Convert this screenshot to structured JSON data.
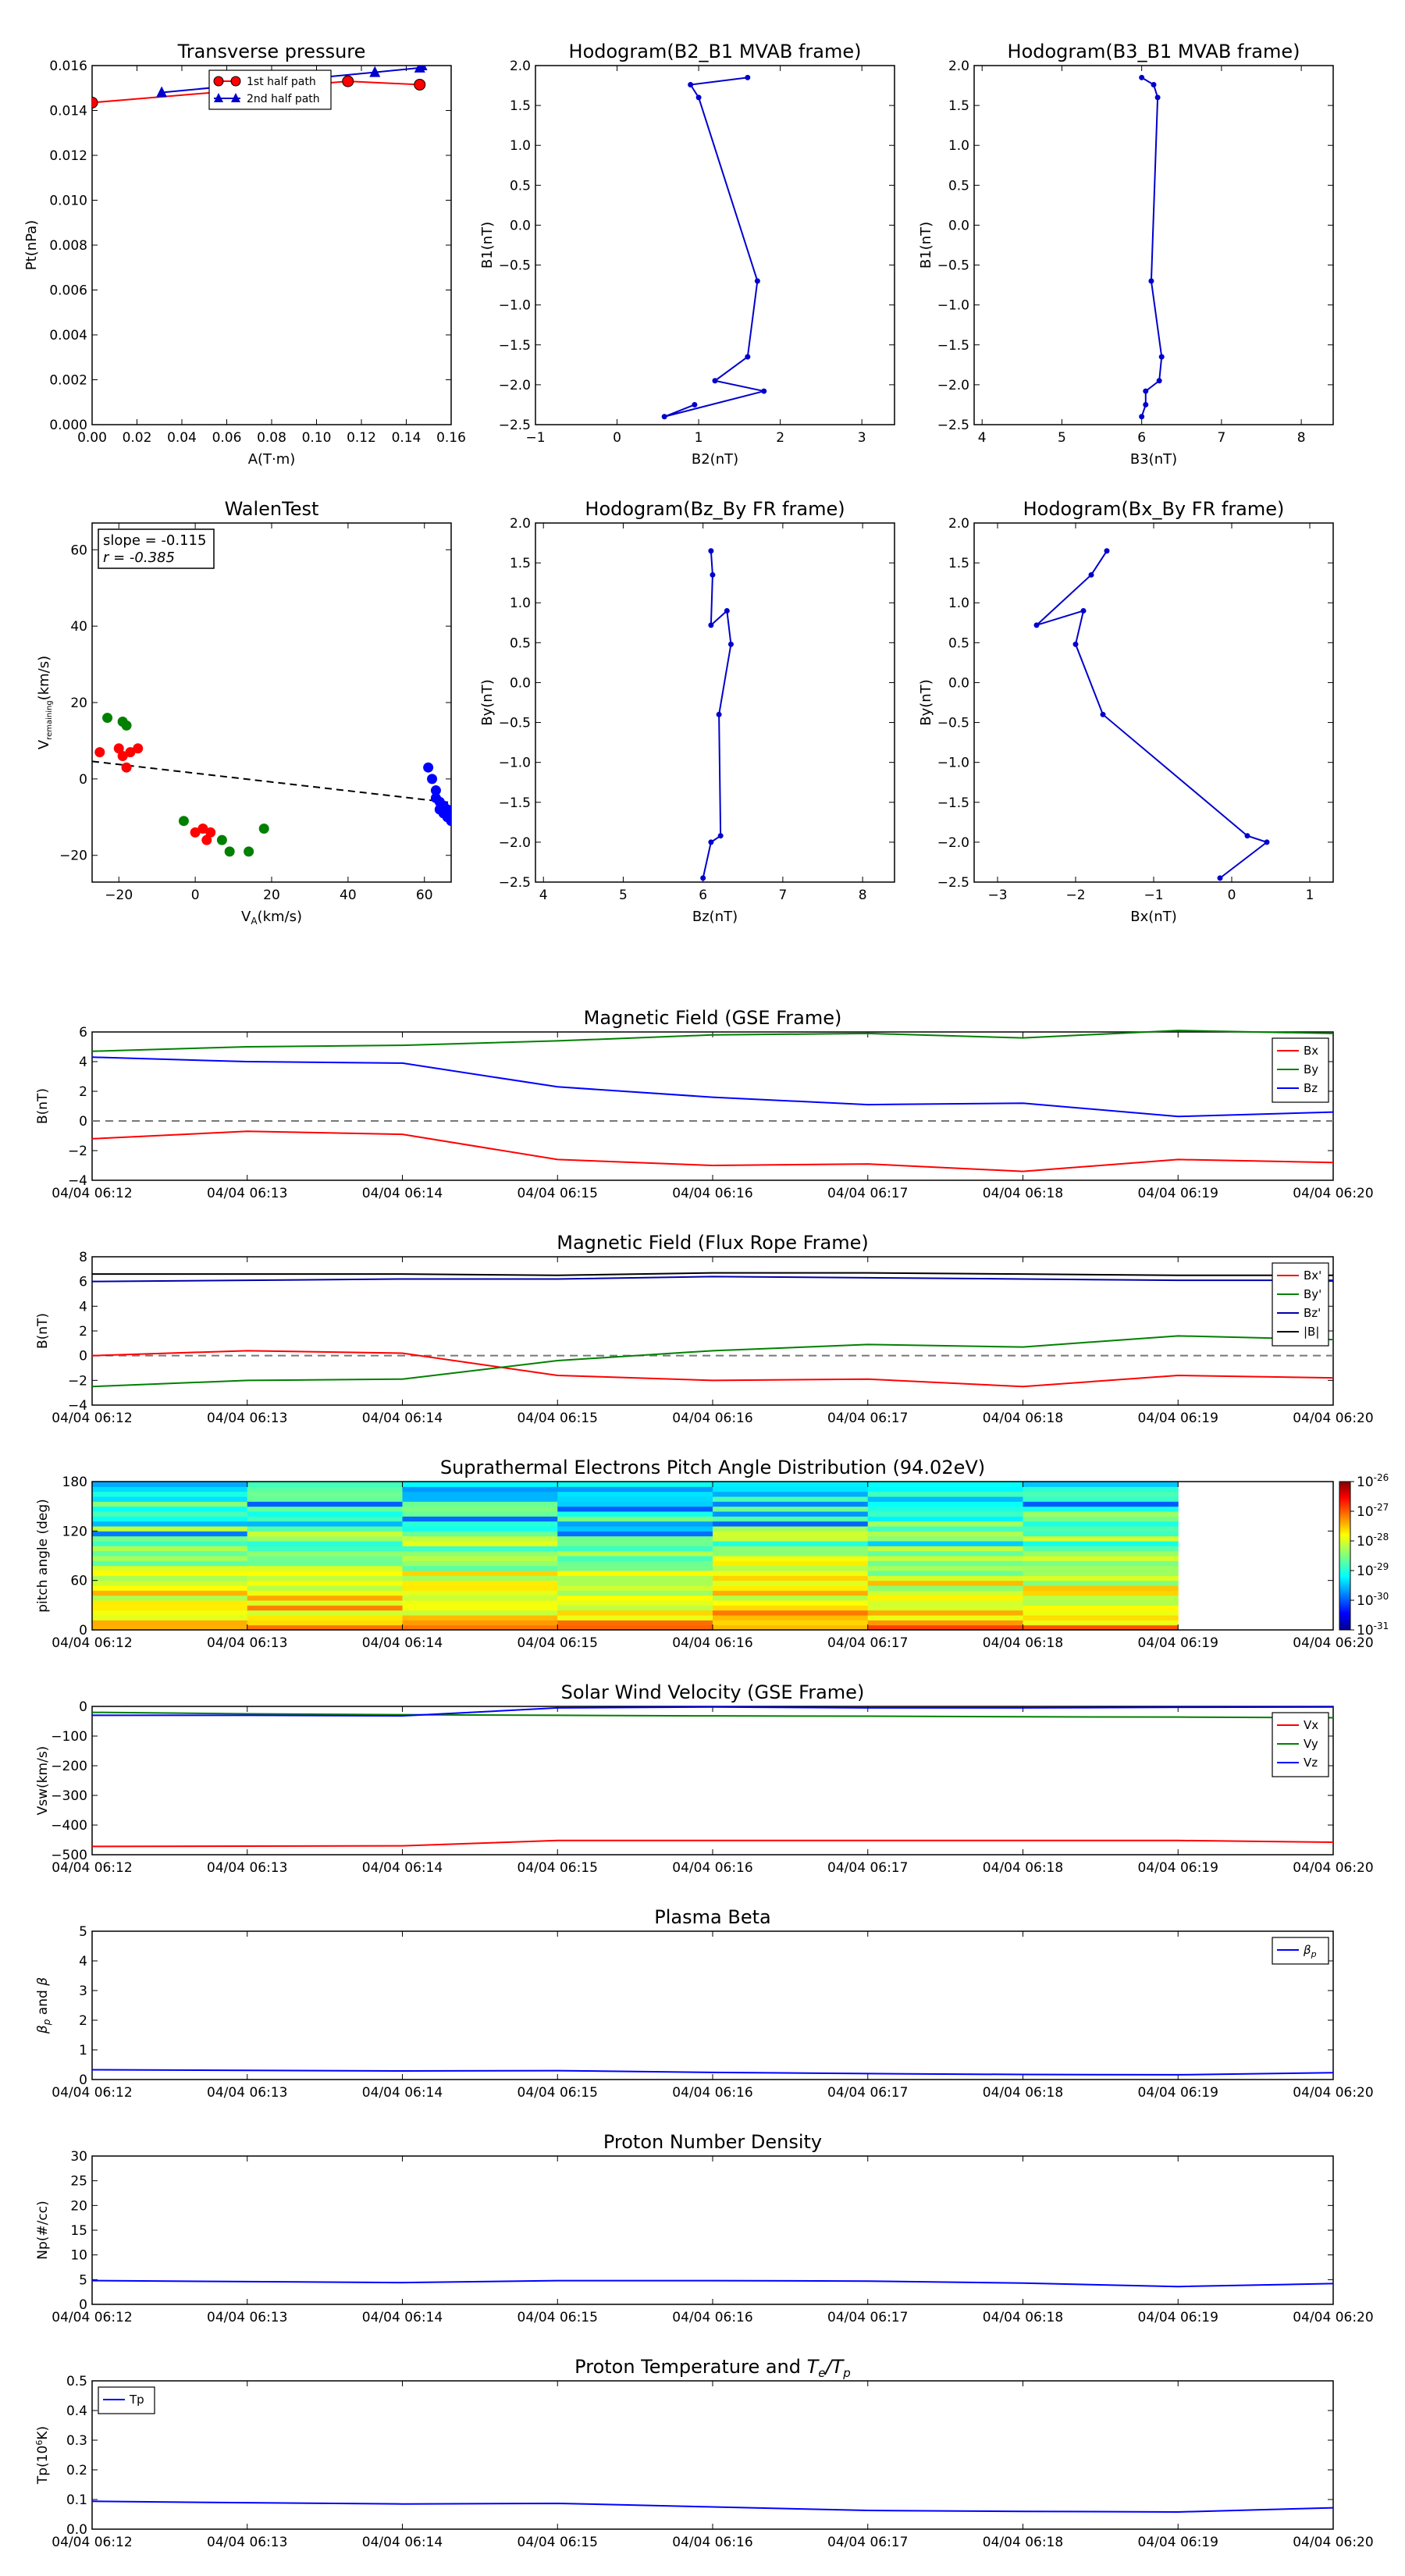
{
  "hodograms": [
    {
      "title": "Transverse pressure",
      "type": "line",
      "xlabel": "A(T·m)",
      "ylabel": "Pt(nPa)",
      "xlim": [
        0,
        0.16
      ],
      "ylim": [
        0,
        0.016
      ],
      "xticks": [
        0,
        0.02,
        0.04,
        0.06,
        0.08,
        0.1,
        0.12,
        0.14,
        0.16
      ],
      "xtick_labels": [
        "0.00",
        "0.02",
        "0.04",
        "0.06",
        "0.08",
        "0.10",
        "0.12",
        "0.14",
        "0.16"
      ],
      "yticks": [
        0,
        0.002,
        0.004,
        0.006,
        0.008,
        0.01,
        0.012,
        0.014,
        0.016
      ],
      "ytick_labels": [
        "0.000",
        "0.002",
        "0.004",
        "0.006",
        "0.008",
        "0.010",
        "0.012",
        "0.014",
        "0.016"
      ],
      "legend": {
        "position": "top-center",
        "entries": [
          "1st half path",
          "2nd half path"
        ]
      },
      "series": [
        {
          "name": "1st half path",
          "color": "#ff0000",
          "marker": "circle",
          "x": [
            0.0,
            0.114,
            0.146
          ],
          "y": [
            0.01435,
            0.0153,
            0.01515
          ]
        },
        {
          "name": "2nd half path",
          "color": "#0000cc",
          "marker": "triangle",
          "x": [
            0.031,
            0.126,
            0.146,
            0.147
          ],
          "y": [
            0.0148,
            0.0157,
            0.0159,
            0.016
          ]
        }
      ]
    },
    {
      "title": "Hodogram(B2_B1 MVAB frame)",
      "type": "line",
      "xlabel": "B2(nT)",
      "ylabel": "B1(nT)",
      "xlim": [
        -1,
        3.4
      ],
      "ylim": [
        -2.5,
        2.0
      ],
      "xticks": [
        -1,
        0,
        1,
        2,
        3
      ],
      "xtick_labels": [
        "−1",
        "0",
        "1",
        "2",
        "3"
      ],
      "yticks": [
        -2.5,
        -2.0,
        -1.5,
        -1.0,
        -0.5,
        0,
        0.5,
        1.0,
        1.5,
        2.0
      ],
      "ytick_labels": [
        "−2.5",
        "−2.0",
        "−1.5",
        "−1.0",
        "−0.5",
        "0.0",
        "0.5",
        "1.0",
        "1.5",
        "2.0"
      ],
      "series": [
        {
          "color": "#0000cc",
          "marker": "dot",
          "x": [
            1.6,
            0.9,
            1.0,
            1.72,
            1.6,
            1.2,
            1.8,
            0.58,
            0.95
          ],
          "y": [
            1.85,
            1.76,
            1.6,
            -0.7,
            -1.65,
            -1.95,
            -2.08,
            -2.4,
            -2.25
          ]
        }
      ]
    },
    {
      "title": "Hodogram(B3_B1 MVAB frame)",
      "type": "line",
      "xlabel": "B3(nT)",
      "ylabel": "B1(nT)",
      "xlim": [
        3.9,
        8.4
      ],
      "ylim": [
        -2.5,
        2.0
      ],
      "xticks": [
        4,
        5,
        6,
        7,
        8
      ],
      "xtick_labels": [
        "4",
        "5",
        "6",
        "7",
        "8"
      ],
      "yticks": [
        -2.5,
        -2.0,
        -1.5,
        -1.0,
        -0.5,
        0,
        0.5,
        1.0,
        1.5,
        2.0
      ],
      "ytick_labels": [
        "−2.5",
        "−2.0",
        "−1.5",
        "−1.0",
        "−0.5",
        "0.0",
        "0.5",
        "1.0",
        "1.5",
        "2.0"
      ],
      "series": [
        {
          "color": "#0000cc",
          "marker": "dot",
          "x": [
            6.0,
            6.15,
            6.2,
            6.12,
            6.25,
            6.22,
            6.05,
            6.05,
            6.0
          ],
          "y": [
            1.85,
            1.76,
            1.6,
            -0.7,
            -1.65,
            -1.95,
            -2.08,
            -2.25,
            -2.4
          ]
        }
      ]
    },
    {
      "title": "WalenTest",
      "type": "scatter",
      "xlabel": "V_A(km/s)",
      "ylabel": "V_remaining(km/s)",
      "xlim": [
        -27,
        67
      ],
      "ylim": [
        -27,
        67
      ],
      "xticks": [
        -20,
        0,
        20,
        40,
        60
      ],
      "xtick_labels": [
        "−20",
        "0",
        "20",
        "40",
        "60"
      ],
      "yticks": [
        -20,
        0,
        20,
        40,
        60
      ],
      "ytick_labels": [
        "−20",
        "0",
        "20",
        "40",
        "60"
      ],
      "annotation": [
        "slope = -0.115",
        "r = -0.385"
      ],
      "fit_line": {
        "slope": -0.115,
        "intercept": 1.5,
        "x": [
          -27,
          67
        ]
      },
      "series": [
        {
          "color": "#ff0000",
          "x": [
            -25,
            -20,
            -17,
            -15,
            -19,
            -18,
            0,
            2,
            4,
            3
          ],
          "y": [
            7,
            8,
            7,
            8,
            6,
            3,
            -14,
            -13,
            -14,
            -16
          ]
        },
        {
          "color": "#008000",
          "x": [
            -23,
            -19,
            -18,
            -3,
            7,
            9,
            14,
            18
          ],
          "y": [
            16,
            15,
            14,
            -11,
            -16,
            -19,
            -19,
            -13
          ]
        },
        {
          "color": "#0000ff",
          "x": [
            61,
            62,
            63,
            63,
            64,
            64,
            65,
            65,
            66,
            66,
            66,
            67
          ],
          "y": [
            3,
            0,
            -3,
            -5,
            -6,
            -8,
            -7,
            -9,
            -9,
            -8,
            -10,
            -11
          ]
        }
      ]
    },
    {
      "title": "Hodogram(Bz_By FR frame)",
      "type": "line",
      "xlabel": "Bz(nT)",
      "ylabel": "By(nT)",
      "xlim": [
        3.9,
        8.4
      ],
      "ylim": [
        -2.5,
        2.0
      ],
      "xticks": [
        4,
        5,
        6,
        7,
        8
      ],
      "xtick_labels": [
        "4",
        "5",
        "6",
        "7",
        "8"
      ],
      "yticks": [
        -2.5,
        -2.0,
        -1.5,
        -1.0,
        -0.5,
        0,
        0.5,
        1.0,
        1.5,
        2.0
      ],
      "ytick_labels": [
        "−2.5",
        "−2.0",
        "−1.5",
        "−1.0",
        "−0.5",
        "0.0",
        "0.5",
        "1.0",
        "1.5",
        "2.0"
      ],
      "series": [
        {
          "color": "#0000cc",
          "marker": "dot",
          "x": [
            6.1,
            6.12,
            6.1,
            6.3,
            6.35,
            6.2,
            6.22,
            6.1,
            6.0
          ],
          "y": [
            1.65,
            1.35,
            0.72,
            0.9,
            0.48,
            -0.4,
            -1.92,
            -2.0,
            -2.45
          ]
        }
      ]
    },
    {
      "title": "Hodogram(Bx_By FR frame)",
      "type": "line",
      "xlabel": "Bx(nT)",
      "ylabel": "By(nT)",
      "xlim": [
        -3.3,
        1.3
      ],
      "ylim": [
        -2.5,
        2.0
      ],
      "xticks": [
        -3,
        -2,
        -1,
        0,
        1
      ],
      "xtick_labels": [
        "−3",
        "−2",
        "−1",
        "0",
        "1"
      ],
      "yticks": [
        -2.5,
        -2.0,
        -1.5,
        -1.0,
        -0.5,
        0,
        0.5,
        1.0,
        1.5,
        2.0
      ],
      "ytick_labels": [
        "−2.5",
        "−2.0",
        "−1.5",
        "−1.0",
        "−0.5",
        "0.0",
        "0.5",
        "1.0",
        "1.5",
        "2.0"
      ],
      "series": [
        {
          "color": "#0000cc",
          "marker": "dot",
          "x": [
            -1.6,
            -1.8,
            -2.5,
            -1.9,
            -2.0,
            -1.65,
            0.2,
            0.45,
            -0.15
          ],
          "y": [
            1.65,
            1.35,
            0.72,
            0.9,
            0.48,
            -0.4,
            -1.92,
            -2.0,
            -2.45
          ]
        }
      ]
    }
  ],
  "time_axis": {
    "tick_labels": [
      "04/04 06:12",
      "04/04 06:13",
      "04/04 06:14",
      "04/04 06:15",
      "04/04 06:16",
      "04/04 06:17",
      "04/04 06:18",
      "04/04 06:19",
      "04/04 06:20"
    ],
    "tick_minutes": [
      12,
      13,
      14,
      15,
      16,
      17,
      18,
      19,
      20
    ],
    "xlim_minutes": [
      12,
      20
    ],
    "sample_minutes": [
      12,
      13,
      14,
      15,
      16,
      17,
      18,
      19,
      20
    ]
  },
  "timeseries": [
    {
      "title": "Magnetic Field (GSE Frame)",
      "type": "line",
      "ylabel": "B(nT)",
      "ylim": [
        -4,
        6
      ],
      "yticks": [
        -4,
        -2,
        0,
        2,
        4,
        6
      ],
      "ytick_labels": [
        "−4",
        "−2",
        "0",
        "2",
        "4",
        "6"
      ],
      "zero_line": true,
      "legend": {
        "position": "top-right"
      },
      "series": [
        {
          "name": "Bx",
          "color": "#ff0000",
          "values": [
            -1.2,
            -0.7,
            -0.9,
            -2.6,
            -3.0,
            -2.9,
            -3.4,
            -2.6,
            -2.8
          ]
        },
        {
          "name": "By",
          "color": "#008000",
          "values": [
            4.7,
            5.0,
            5.1,
            5.4,
            5.8,
            5.9,
            5.6,
            6.1,
            5.9
          ]
        },
        {
          "name": "Bz",
          "color": "#0000ff",
          "values": [
            4.3,
            4.0,
            3.9,
            2.3,
            1.6,
            1.1,
            1.2,
            0.3,
            0.6
          ]
        }
      ]
    },
    {
      "title": "Magnetic Field (Flux Rope Frame)",
      "type": "line",
      "ylabel": "B(nT)",
      "ylim": [
        -4,
        8
      ],
      "yticks": [
        -4,
        -2,
        0,
        2,
        4,
        6,
        8
      ],
      "ytick_labels": [
        "−4",
        "−2",
        "0",
        "2",
        "4",
        "6",
        "8"
      ],
      "zero_line": true,
      "legend": {
        "position": "top-right"
      },
      "series": [
        {
          "name": "Bx'",
          "color": "#ff0000",
          "values": [
            0.0,
            0.4,
            0.2,
            -1.6,
            -2.0,
            -1.9,
            -2.5,
            -1.6,
            -1.8
          ]
        },
        {
          "name": "By'",
          "color": "#008000",
          "values": [
            -2.5,
            -2.0,
            -1.9,
            -0.4,
            0.4,
            0.9,
            0.7,
            1.6,
            1.3
          ]
        },
        {
          "name": "Bz'",
          "color": "#0000aa",
          "values": [
            6.0,
            6.1,
            6.2,
            6.2,
            6.4,
            6.3,
            6.2,
            6.1,
            6.1
          ]
        },
        {
          "name": "|B|",
          "color": "#000000",
          "values": [
            6.6,
            6.6,
            6.6,
            6.5,
            6.7,
            6.7,
            6.6,
            6.5,
            6.5
          ]
        }
      ]
    },
    {
      "title": "Suprathermal Electrons Pitch Angle Distribution (94.02eV)",
      "type": "heatmap",
      "ylabel": "pitch angle (deg)",
      "ylim": [
        0,
        180
      ],
      "yticks": [
        0,
        60,
        120,
        180
      ],
      "ytick_labels": [
        "0",
        "60",
        "120",
        "180"
      ],
      "data_end_minute": 19,
      "colorbar": {
        "tick_labels": [
          "10^-26",
          "10^-27",
          "10^-28",
          "10^-29",
          "10^-30",
          "10^-31"
        ]
      }
    },
    {
      "title": "Solar Wind Velocity (GSE Frame)",
      "type": "line",
      "ylabel": "Vsw(km/s)",
      "ylim": [
        -500,
        0
      ],
      "yticks": [
        -500,
        -400,
        -300,
        -200,
        -100,
        0
      ],
      "ytick_labels": [
        "−500",
        "−400",
        "−300",
        "−200",
        "−100",
        "0"
      ],
      "legend": {
        "position": "top-right"
      },
      "series": [
        {
          "name": "Vx",
          "color": "#ff0000",
          "values": [
            -472,
            -471,
            -470,
            -452,
            -452,
            -452,
            -452,
            -452,
            -458
          ]
        },
        {
          "name": "Vy",
          "color": "#008000",
          "values": [
            -20,
            -25,
            -28,
            -30,
            -32,
            -33,
            -35,
            -36,
            -38
          ]
        },
        {
          "name": "Vz",
          "color": "#0000ff",
          "values": [
            -30,
            -30,
            -32,
            -5,
            -2,
            -5,
            -5,
            -3,
            -2
          ]
        }
      ]
    },
    {
      "title": "Plasma Beta",
      "type": "line",
      "ylabel": "β_p and β",
      "ylim": [
        0,
        5
      ],
      "yticks": [
        0,
        1,
        2,
        3,
        4,
        5
      ],
      "ytick_labels": [
        "0",
        "1",
        "2",
        "3",
        "4",
        "5"
      ],
      "legend": {
        "position": "top-right"
      },
      "series": [
        {
          "name": "β_p",
          "color": "#0000ff",
          "values": [
            0.33,
            0.31,
            0.29,
            0.3,
            0.24,
            0.2,
            0.17,
            0.16,
            0.23
          ]
        }
      ]
    },
    {
      "title": "Proton Number Density",
      "type": "line",
      "ylabel": "Np(#/cc)",
      "ylim": [
        0,
        30
      ],
      "yticks": [
        0,
        5,
        10,
        15,
        20,
        25,
        30
      ],
      "ytick_labels": [
        "0",
        "5",
        "10",
        "15",
        "20",
        "25",
        "30"
      ],
      "series": [
        {
          "color": "#0000ff",
          "values": [
            4.8,
            4.6,
            4.4,
            4.8,
            4.8,
            4.7,
            4.3,
            3.6,
            4.2
          ]
        }
      ]
    },
    {
      "title": "Proton Temperature and T_e/T_p",
      "type": "line",
      "ylabel": "Tp(10^6K)",
      "ylim": [
        0,
        0.5
      ],
      "yticks": [
        0,
        0.1,
        0.2,
        0.3,
        0.4,
        0.5
      ],
      "ytick_labels": [
        "0.0",
        "0.1",
        "0.2",
        "0.3",
        "0.4",
        "0.5"
      ],
      "legend": {
        "position": "top-left"
      },
      "series": [
        {
          "name": "Tp",
          "color": "#0000ff",
          "values": [
            0.094,
            0.089,
            0.085,
            0.087,
            0.075,
            0.063,
            0.06,
            0.058,
            0.072
          ]
        }
      ]
    }
  ]
}
